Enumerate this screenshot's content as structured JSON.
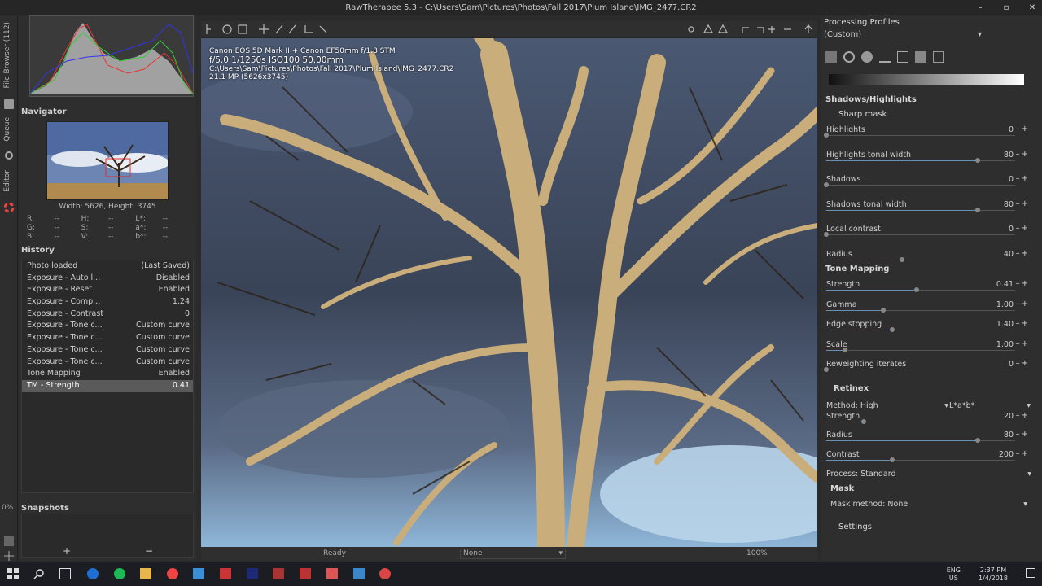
{
  "window": {
    "title": "RawTherapee 5.3 - C:\\Users\\Sam\\Pictures\\Photos\\Fall 2017\\Plum Island\\IMG_2477.CR2"
  },
  "vertical_tabs": {
    "file_browser": "File Browser (112)",
    "queue": "Queue",
    "editor": "Editor",
    "zoom_label": "0%"
  },
  "navigator": {
    "title": "Navigator",
    "size": "Width: 5626, Height: 3745",
    "rows": [
      {
        "a": "R:",
        "b": "--",
        "c": "H:",
        "d": "--",
        "e": "L*:",
        "f": "--"
      },
      {
        "a": "G:",
        "b": "--",
        "c": "S:",
        "d": "--",
        "e": "a*:",
        "f": "--"
      },
      {
        "a": "B:",
        "b": "--",
        "c": "V:",
        "d": "--",
        "e": "b*:",
        "f": "--"
      }
    ]
  },
  "history": {
    "title": "History",
    "items": [
      {
        "name": "Photo loaded",
        "value": "(Last Saved)"
      },
      {
        "name": "Exposure - Auto l...",
        "value": "Disabled"
      },
      {
        "name": "Exposure - Reset",
        "value": "Enabled"
      },
      {
        "name": "Exposure - Comp...",
        "value": "1.24"
      },
      {
        "name": "Exposure - Contrast",
        "value": "0"
      },
      {
        "name": "Exposure - Tone c...",
        "value": "Custom curve"
      },
      {
        "name": "Exposure - Tone c...",
        "value": "Custom curve"
      },
      {
        "name": "Exposure - Tone c...",
        "value": "Custom curve"
      },
      {
        "name": "Exposure - Tone c...",
        "value": "Custom curve"
      },
      {
        "name": "Tone Mapping",
        "value": "Enabled"
      },
      {
        "name": "TM - Strength",
        "value": "0.41"
      }
    ],
    "selected_index": 10
  },
  "snapshots": {
    "title": "Snapshots",
    "add": "+",
    "remove": "−"
  },
  "image_info": {
    "camera": "Canon EOS 5D Mark II + Canon EF50mm f/1.8 STM",
    "exposure": "f/5.0  1/1250s  ISO100  50.00mm",
    "path": "C:\\Users\\Sam\\Pictures\\Photos\\Fall 2017\\Plum Island\\IMG_2477.CR2",
    "mp": "21.1 MP (5626x3745)"
  },
  "status": {
    "ready": "Ready",
    "preview_profile": "None",
    "zoom": "100%"
  },
  "processing_profiles": {
    "title": "Processing Profiles",
    "current": "(Custom)"
  },
  "shadows_highlights": {
    "title": "Shadows/Highlights",
    "sharp_mask": "Sharp mask",
    "sliders": [
      {
        "label": "Highlights",
        "value": "0",
        "frac": 0.0
      },
      {
        "label": "Highlights tonal width",
        "value": "80",
        "frac": 0.8
      },
      {
        "label": "Shadows",
        "value": "0",
        "frac": 0.0
      },
      {
        "label": "Shadows tonal width",
        "value": "80",
        "frac": 0.8
      },
      {
        "label": "Local contrast",
        "value": "0",
        "frac": 0.0
      },
      {
        "label": "Radius",
        "value": "40",
        "frac": 0.4
      }
    ]
  },
  "tone_mapping": {
    "title": "Tone Mapping",
    "sliders": [
      {
        "label": "Strength",
        "value": "0.41",
        "frac": 0.48
      },
      {
        "label": "Gamma",
        "value": "1.00",
        "frac": 0.3
      },
      {
        "label": "Edge stopping",
        "value": "1.40",
        "frac": 0.35
      },
      {
        "label": "Scale",
        "value": "1.00",
        "frac": 0.1
      },
      {
        "label": "Reweighting iterates",
        "value": "0",
        "frac": 0.0
      }
    ]
  },
  "retinex": {
    "title": "Retinex",
    "method": "Method: High",
    "colorspace": "L*a*b*",
    "sliders": [
      {
        "label": "Strength",
        "value": "20",
        "frac": 0.2
      },
      {
        "label": "Radius",
        "value": "80",
        "frac": 0.8
      },
      {
        "label": "Contrast",
        "value": "200",
        "frac": 0.35
      }
    ],
    "process": "Process: Standard",
    "mask": "Mask",
    "mask_method": "Mask method: None",
    "settings": "Settings"
  },
  "tray": {
    "lang": "ENG",
    "region": "US",
    "time": "2:37 PM",
    "date": "1/4/2018"
  },
  "colors": {
    "accent": "#6a8fb5",
    "panel": "#2e2e2e",
    "taskbar": "#1b1d22"
  }
}
